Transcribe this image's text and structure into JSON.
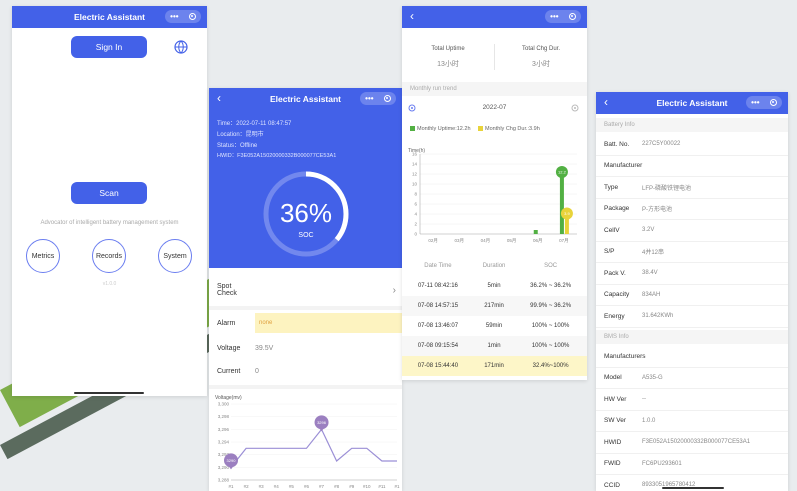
{
  "app": {
    "title": "Electric Assistant",
    "more_icon": "•••",
    "back_icon": "‹"
  },
  "screen1": {
    "sign_in": "Sign In",
    "scan": "Scan",
    "tagline": "Advocator of intelligent battery management system",
    "buttons": [
      "Metrics",
      "Records",
      "System"
    ],
    "version": "v1.0.0"
  },
  "screen2": {
    "time": "Time：2022-07-11 08:47:57",
    "location": "Location：昆明市",
    "status": "Status：Offline",
    "hwid": "HWID：F3E052A15020000332B000077CE53A1",
    "soc_value": 36,
    "soc_text": "36%",
    "soc_label": "SOC",
    "spot_check": "Spot Check",
    "alarm_label": "Alarm",
    "alarm_value": "none",
    "voltage_label": "Voltage",
    "voltage_value": "39.5V",
    "current_label": "Current",
    "current_value": "0",
    "chevron": "›"
  },
  "screen3": {
    "total_uptime_label": "Total Uptime",
    "total_uptime_value": "13小时",
    "total_chg_label": "Total Chg Dur.",
    "total_chg_value": "3小时",
    "monthly_trend": "Monthly run trend",
    "month": "2022-07",
    "legend_uptime": "Monthly Uptime:12.2h",
    "legend_chg": "Monthly Chg Dur.:3.9h",
    "table_headers": [
      "Date Time",
      "Duration",
      "SOC"
    ],
    "table_rows": [
      [
        "07-11 08:42:16",
        "5min",
        "36.2% ~ 36.2%"
      ],
      [
        "07-08 14:57:15",
        "217min",
        "99.9% ~ 36.2%"
      ],
      [
        "07-08 13:46:07",
        "59min",
        "100% ~ 100%"
      ],
      [
        "07-08 09:15:54",
        "1min",
        "100% ~ 100%"
      ],
      [
        "07-08 15:44:40",
        "171min",
        "32.4%~100%"
      ]
    ]
  },
  "screen4": {
    "battery_info": "Battery Info",
    "bms_info": "BMS Info",
    "battery_rows": [
      [
        "Batt. No.",
        "227C5Y00022"
      ],
      [
        "Manufacturer",
        ""
      ],
      [
        "Type",
        "LFP-磷酸铁锂电池"
      ],
      [
        "Package",
        "P-方形电池"
      ],
      [
        "CellV",
        "3.2V"
      ],
      [
        "S/P",
        "4并12串"
      ],
      [
        "Pack V.",
        "38.4V"
      ],
      [
        "Capacity",
        "834AH"
      ],
      [
        "Energy",
        "31.642KWh"
      ]
    ],
    "bms_rows": [
      [
        "Manufacturers",
        ""
      ],
      [
        "Model",
        "A535-G"
      ],
      [
        "HW Ver",
        "--"
      ],
      [
        "SW Ver",
        "1.0.0"
      ],
      [
        "HWID",
        "F3E052A15020000332B000077CE53A1"
      ],
      [
        "FWID",
        "FC6PU293601"
      ],
      [
        "CCID",
        "8933051965780412"
      ]
    ]
  },
  "chart_data": [
    {
      "type": "bar",
      "ylabel": "Time(h)",
      "categories": [
        "02月",
        "03月",
        "04月",
        "05月",
        "06月",
        "07月"
      ],
      "series": [
        {
          "name": "Monthly Uptime",
          "values": [
            0,
            0,
            0,
            0,
            0.8,
            12.2
          ],
          "color": "#52b043"
        },
        {
          "name": "Monthly Chg Dur.",
          "values": [
            0,
            0,
            0,
            0,
            0,
            3.9
          ],
          "color": "#e8d33a"
        }
      ],
      "ylim": [
        0,
        16
      ],
      "yticks": [
        0,
        2,
        4,
        6,
        8,
        10,
        12,
        14,
        16
      ],
      "labels": [
        "12.2",
        "3.9"
      ]
    },
    {
      "type": "line",
      "ylabel": "Voltage(mv)",
      "categories": [
        "#1",
        "#2",
        "#3",
        "#4",
        "#5",
        "#6",
        "#7",
        "#8",
        "#9",
        "#10",
        "#11",
        "#1"
      ],
      "values": [
        3290,
        3293,
        3293,
        3293,
        3293,
        3293,
        3296,
        3291,
        3293,
        3293,
        3291,
        3291
      ],
      "ylim": [
        3288,
        3300
      ],
      "yticks": [
        "3,288",
        "3,290",
        "3,292",
        "3,294",
        "3,296",
        "3,298",
        "3,300"
      ],
      "markers": [
        "3290",
        "3296"
      ],
      "color": "#9b8fd6"
    }
  ]
}
